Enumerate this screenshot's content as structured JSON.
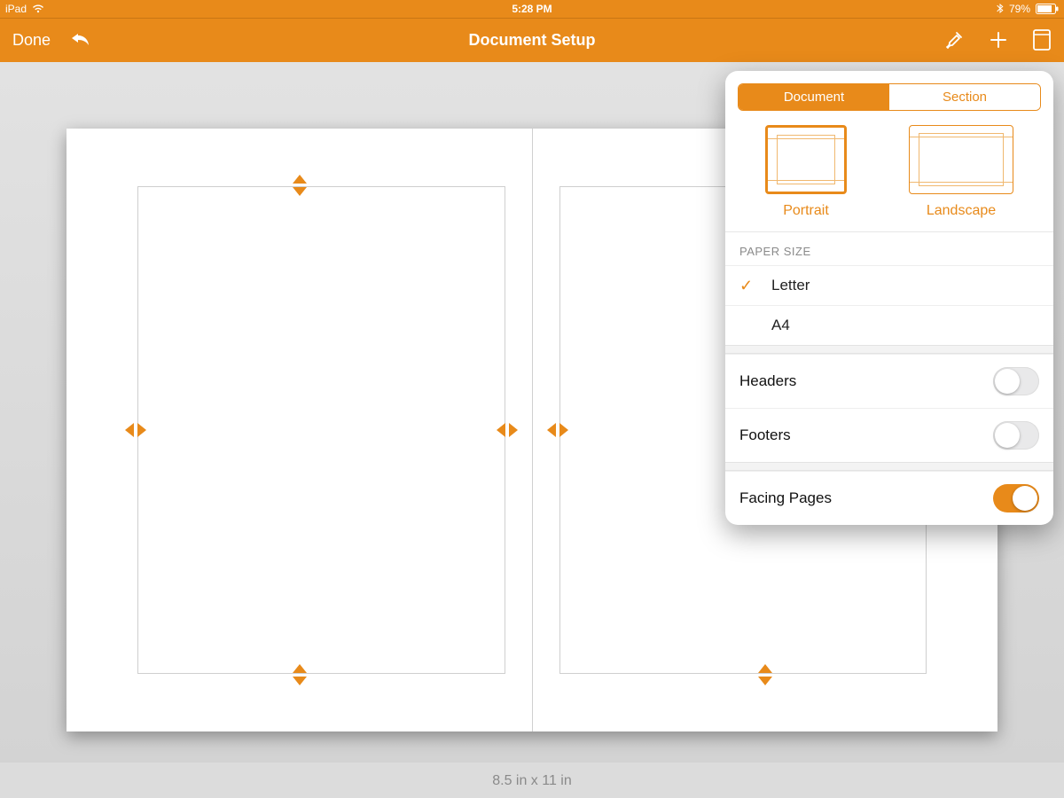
{
  "status": {
    "device": "iPad",
    "time": "5:28 PM",
    "battery_pct": "79%"
  },
  "nav": {
    "done": "Done",
    "title": "Document Setup"
  },
  "footer": {
    "dimensions": "8.5 in x 11 in"
  },
  "popover": {
    "tabs": {
      "document": "Document",
      "section": "Section",
      "active": "document"
    },
    "orientation": {
      "portrait": "Portrait",
      "landscape": "Landscape",
      "selected": "portrait"
    },
    "paper_size": {
      "header": "PAPER SIZE",
      "options": [
        "Letter",
        "A4"
      ],
      "selected": "Letter"
    },
    "toggles": {
      "headers": {
        "label": "Headers",
        "on": false
      },
      "footers": {
        "label": "Footers",
        "on": false
      },
      "facing": {
        "label": "Facing Pages",
        "on": true
      }
    }
  }
}
